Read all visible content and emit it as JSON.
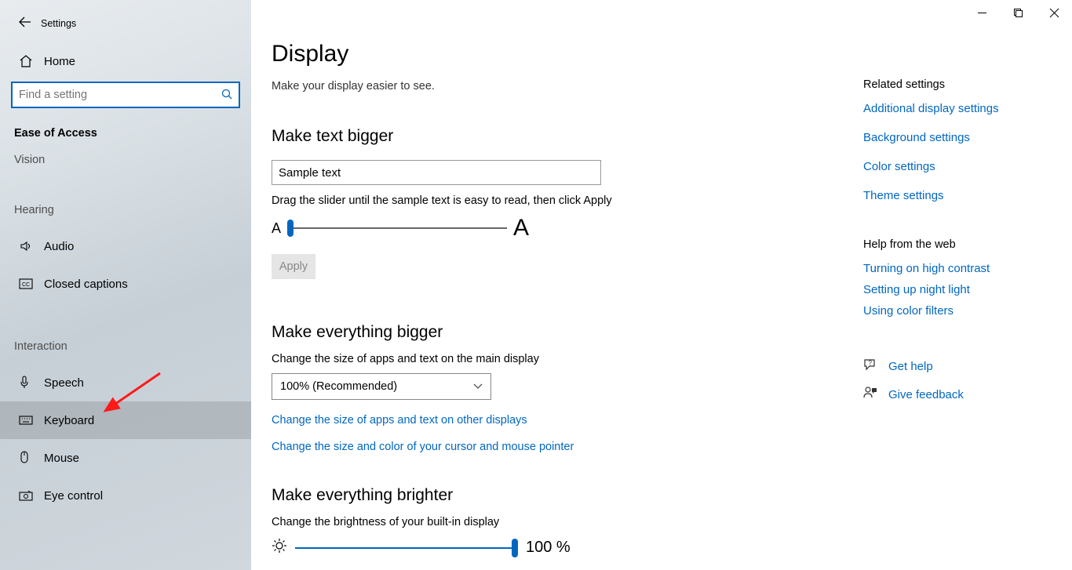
{
  "app_title": "Settings",
  "home_label": "Home",
  "search_placeholder": "Find a setting",
  "category_label": "Ease of Access",
  "subcats": {
    "vision": "Vision",
    "hearing": "Hearing",
    "interaction": "Interaction"
  },
  "nav": {
    "audio": "Audio",
    "closed_captions": "Closed captions",
    "speech": "Speech",
    "keyboard": "Keyboard",
    "mouse": "Mouse",
    "eye_control": "Eye control"
  },
  "page": {
    "title": "Display",
    "subtitle": "Make your display easier to see."
  },
  "text_bigger": {
    "heading": "Make text bigger",
    "sample": "Sample text",
    "caption": "Drag the slider until the sample text is easy to read, then click Apply",
    "apply": "Apply"
  },
  "everything_bigger": {
    "heading": "Make everything bigger",
    "desc": "Change the size of apps and text on the main display",
    "selected": "100% (Recommended)",
    "link1": "Change the size of apps and text on other displays",
    "link2": "Change the size and color of your cursor and mouse pointer"
  },
  "brighter": {
    "heading": "Make everything brighter",
    "desc": "Change the brightness of your built-in display",
    "value": "100 %"
  },
  "rail": {
    "related_heading": "Related settings",
    "links": {
      "additional_display": "Additional display settings",
      "background": "Background settings",
      "color": "Color settings",
      "theme": "Theme settings"
    },
    "help_heading": "Help from the web",
    "help_links": {
      "high_contrast": "Turning on high contrast",
      "night_light": "Setting up night light",
      "color_filters": "Using color filters"
    },
    "get_help": "Get help",
    "give_feedback": "Give feedback"
  }
}
